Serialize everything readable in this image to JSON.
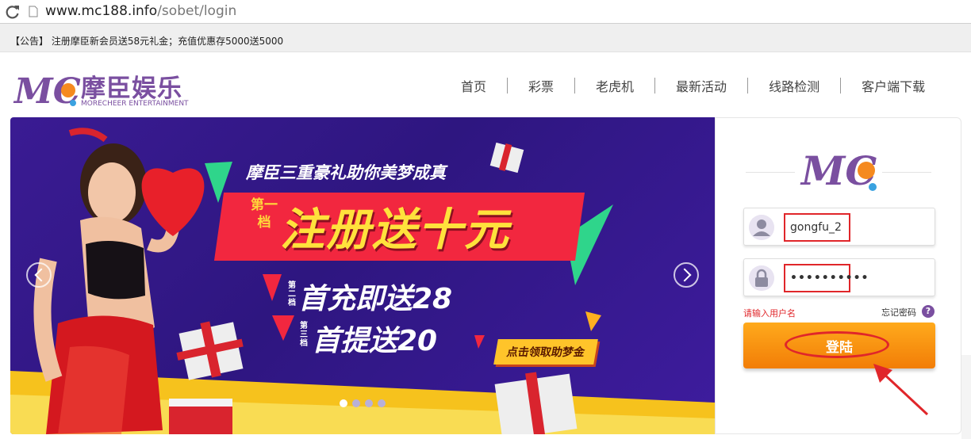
{
  "browser": {
    "url_host": "www.mc188.info",
    "url_path": "/sobet/login"
  },
  "notice": {
    "text": "【公告】 注册摩臣新会员送58元礼金；充值优惠存5000送5000"
  },
  "header": {
    "logo_cn": "摩臣娱乐",
    "logo_en": "MORECHEER ENTERTAINMENT",
    "logo_mark": "MC",
    "nav": [
      "首页",
      "彩票",
      "老虎机",
      "最新活动",
      "线路检测",
      "客户端下载"
    ]
  },
  "banner": {
    "headline": "摩臣三重豪礼助你美梦成真",
    "tier1_tag": "第一档",
    "tier1_text": "注册送十元",
    "tier2_tag": "第二档",
    "tier2_text": "首充即送28",
    "tier3_tag": "第三档",
    "tier3_text": "首提送20",
    "cta": "点击领取助梦金",
    "slides": 4,
    "active_slide": 1
  },
  "login": {
    "username_value": "gongfu_2",
    "password_value": "••••••••••",
    "hint": "请输入用户名",
    "forgot": "忘记密码",
    "help_icon": "?",
    "submit_label": "登陆"
  },
  "colors": {
    "brand_purple": "#7a4fa0",
    "banner_bg": "#2e1680",
    "button_orange": "#f89312",
    "annotation_red": "#e0262a"
  },
  "icons": [
    "reload-icon",
    "page-icon",
    "user-icon",
    "lock-icon",
    "help-icon",
    "chevron-left-icon",
    "chevron-right-icon"
  ]
}
